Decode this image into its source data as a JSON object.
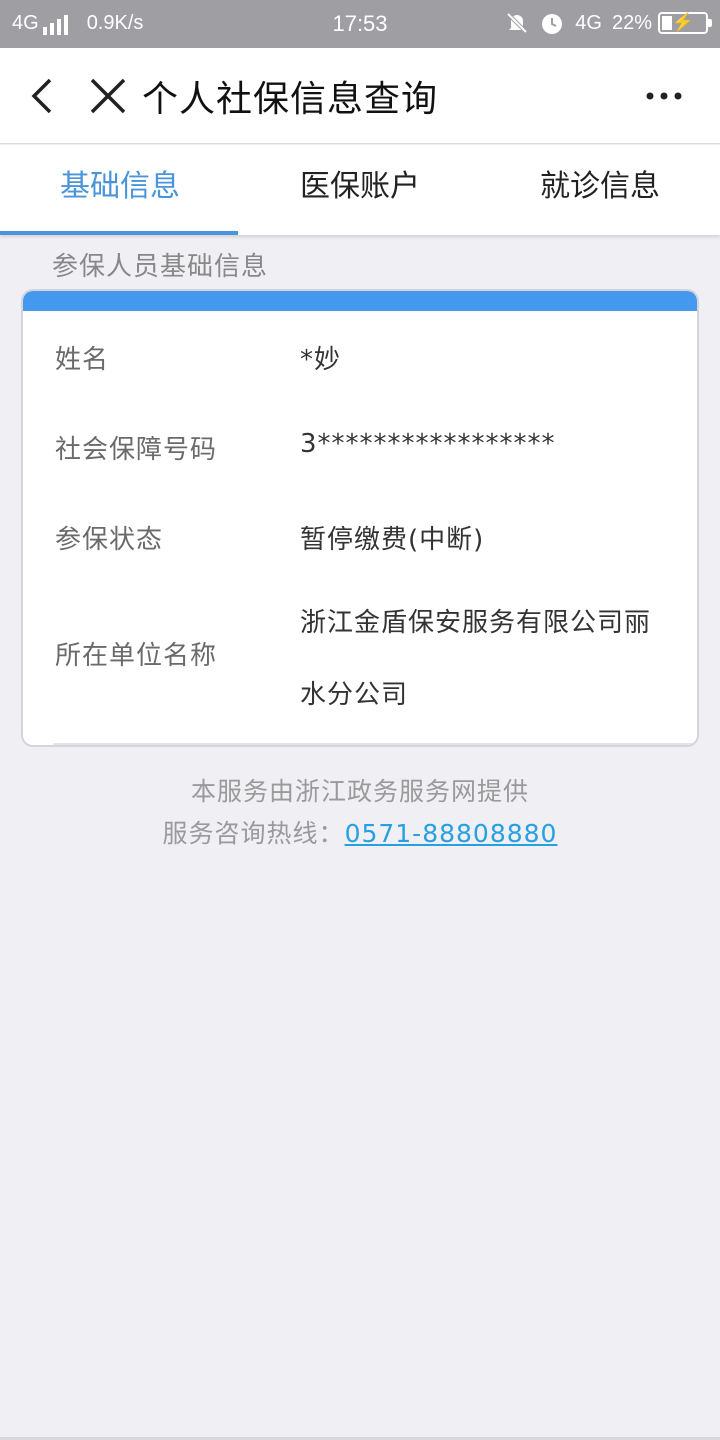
{
  "status_bar": {
    "network_left": "4G",
    "speed": "0.9K/s",
    "time": "17:53",
    "network_right": "4G",
    "battery": "22%"
  },
  "nav": {
    "title": "个人社保信息查询",
    "icons": [
      "back-icon",
      "close-icon",
      "more-icon"
    ]
  },
  "tabs": [
    {
      "label": "基础信息",
      "active": true
    },
    {
      "label": "医保账户",
      "active": false
    },
    {
      "label": "就诊信息",
      "active": false
    }
  ],
  "section": {
    "title": "参保人员基础信息",
    "rows": [
      {
        "label": "姓名",
        "value": "*妙"
      },
      {
        "label": "社会保障号码",
        "value": "3*****************"
      },
      {
        "label": "参保状态",
        "value": "暂停缴费(中断)"
      },
      {
        "label": "所在单位名称",
        "value": "浙江金盾保安服务有限公司丽水分公司"
      }
    ]
  },
  "footer": {
    "provider": "本服务由浙江政务服务网提供",
    "hotline_label": "服务咨询热线：",
    "hotline_number": "0571-88808880"
  },
  "colors": {
    "accent": "#4a95d9",
    "card_header": "#4499ee",
    "link": "#26a0e0",
    "background": "#efeff4"
  }
}
